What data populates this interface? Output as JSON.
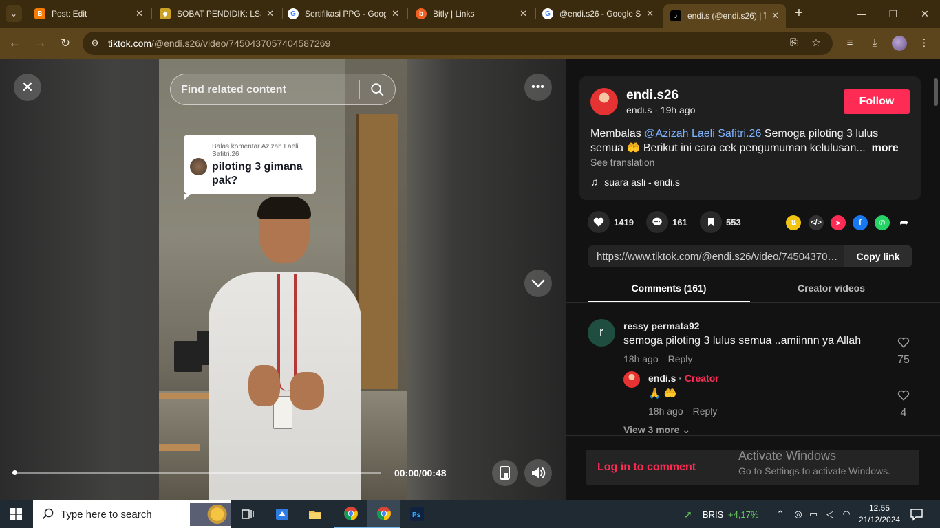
{
  "browser": {
    "tabs": [
      {
        "title": "Post: Edit",
        "favicon": "blogger-icon",
        "color": "#f57c00",
        "active": false
      },
      {
        "title": "SOBAT PENDIDIK: LSS",
        "favicon": "shield-icon",
        "color": "#c9a227",
        "active": false
      },
      {
        "title": "Sertifikasi PPG - Goog",
        "favicon": "google-icon",
        "color": "#4285f4",
        "active": false
      },
      {
        "title": "Bitly | Links",
        "favicon": "bitly-icon",
        "color": "#ee6123",
        "active": false
      },
      {
        "title": "@endi.s26 - Google S",
        "favicon": "google-icon",
        "color": "#4285f4",
        "active": false
      },
      {
        "title": "endi.s (@endi.s26) | T",
        "favicon": "tiktok-icon",
        "color": "#000000",
        "active": true
      }
    ],
    "url_host": "tiktok.com",
    "url_path": "/@endi.s26/video/7450437057404587269"
  },
  "video": {
    "search_placeholder": "Find related content",
    "comment_bubble_small": "Balas komentar Azizah Laeli Safitri.26",
    "comment_bubble_main": "piloting 3 gimana pak?",
    "time": "00:00/00:48",
    "progress": 0.0
  },
  "author": {
    "username": "endi.s26",
    "meta": "endi.s · 19h ago",
    "follow_label": "Follow"
  },
  "description": {
    "prefix": "Membalas ",
    "mention": "@Azizah Laeli Safitri.26",
    "text": " Semoga piloting 3 lulus semua 🤲 Berikut ini cara cek pengumuman kelulusan...",
    "more": "more",
    "see_translation": "See translation",
    "music": "suara asli - endi.s"
  },
  "actions": {
    "likes": "1419",
    "comments": "161",
    "saves": "553"
  },
  "share": {
    "link": "https://www.tiktok.com/@endi.s26/video/7450437057404587269",
    "copy_label": "Copy link"
  },
  "panel_tabs": {
    "comments": "Comments (161)",
    "creator_videos": "Creator videos"
  },
  "comments": [
    {
      "avatar_letter": "r",
      "user": "ressy permata92",
      "text": "semoga piloting 3 lulus semua ..amiinnn ya Allah",
      "time": "18h ago",
      "reply": "Reply",
      "likes": "75"
    }
  ],
  "reply": {
    "user": "endi.s",
    "sep": " · ",
    "creator_label": "Creator",
    "text": "🙏 🤲",
    "time": "18h ago",
    "reply": "Reply",
    "likes": "4"
  },
  "view_more": "View 3 more",
  "login_label": "Log in to comment",
  "watermark": {
    "line1": "Activate Windows",
    "line2": "Go to Settings to activate Windows."
  },
  "taskbar": {
    "search_placeholder": "Type here to search",
    "stock_name": "BRIS",
    "stock_change": "+4,17%",
    "stock_color": "#6ccb5f",
    "time": "12.55",
    "date": "21/12/2024"
  }
}
